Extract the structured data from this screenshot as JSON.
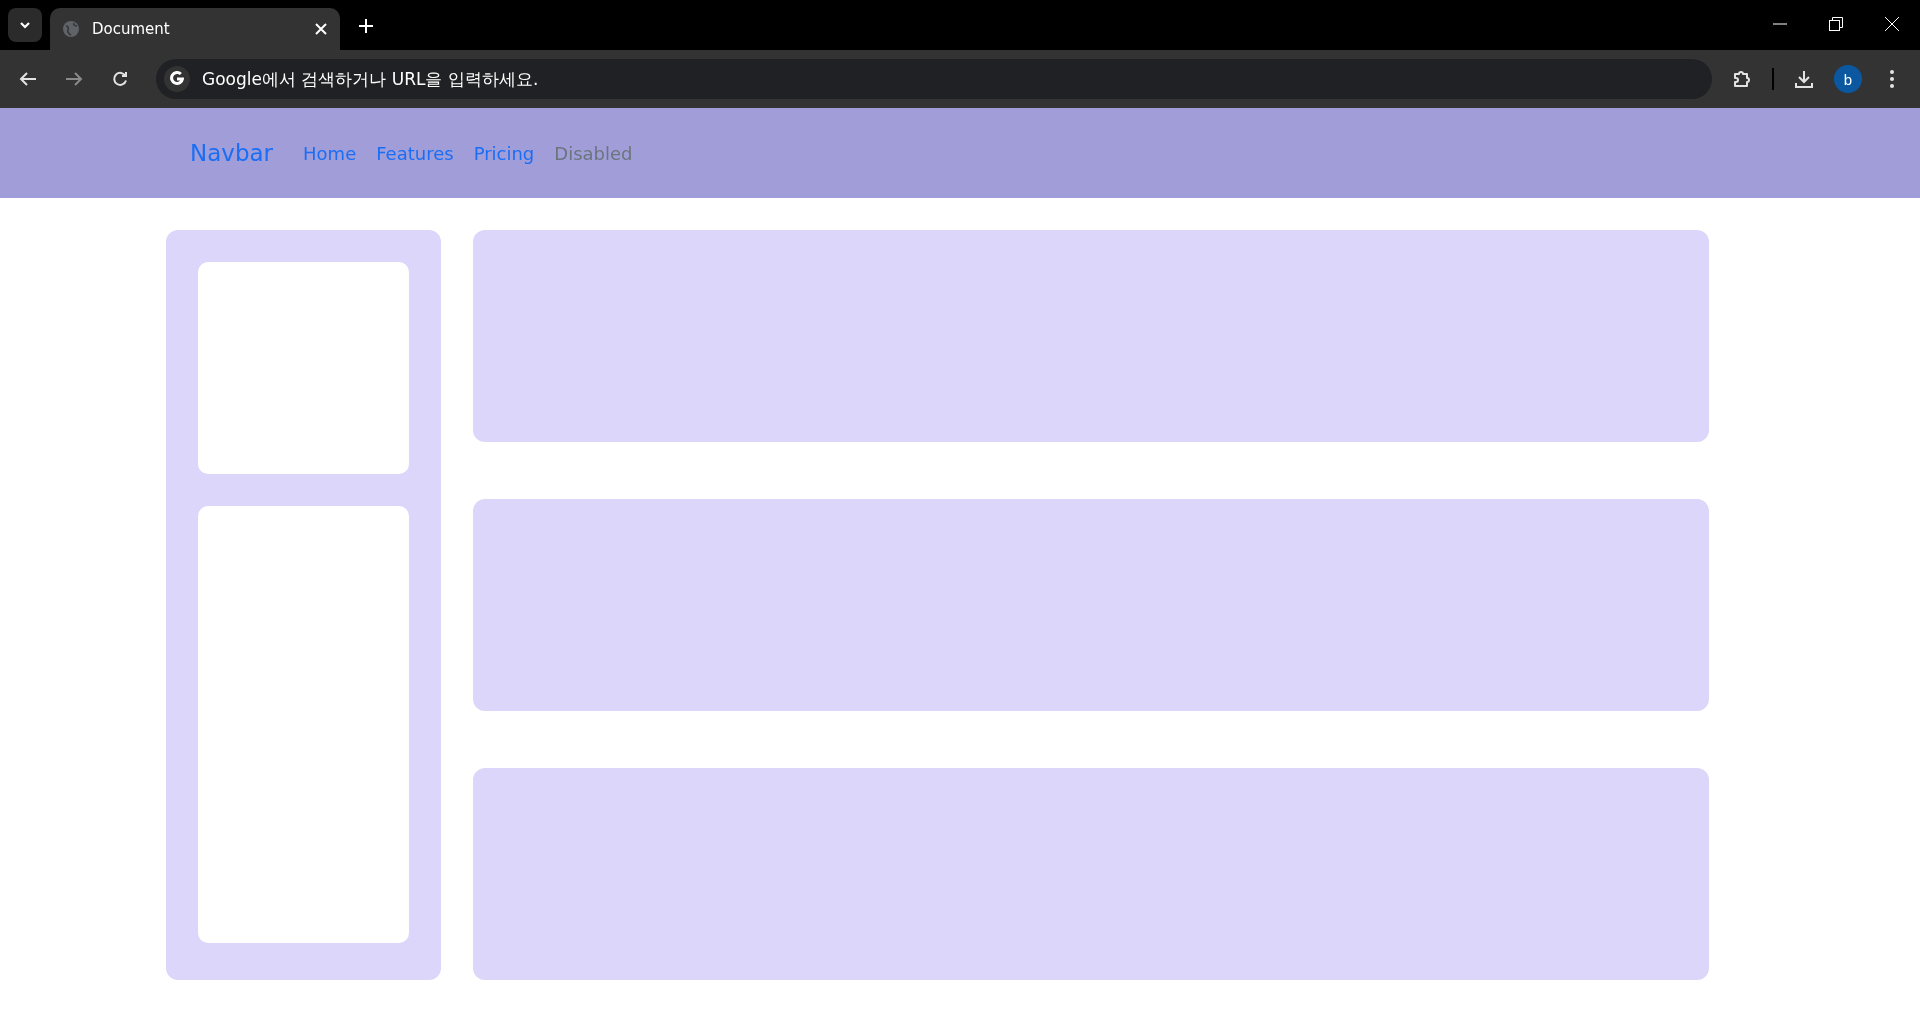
{
  "browser": {
    "tab": {
      "title": "Document"
    },
    "address_bar": {
      "placeholder": "Google에서 검색하거나 URL을 입력하세요."
    },
    "profile": {
      "initial": "b"
    }
  },
  "navbar": {
    "brand": "Navbar",
    "links": [
      {
        "label": "Home",
        "disabled": false
      },
      {
        "label": "Features",
        "disabled": false
      },
      {
        "label": "Pricing",
        "disabled": false
      },
      {
        "label": "Disabled",
        "disabled": true
      }
    ]
  }
}
